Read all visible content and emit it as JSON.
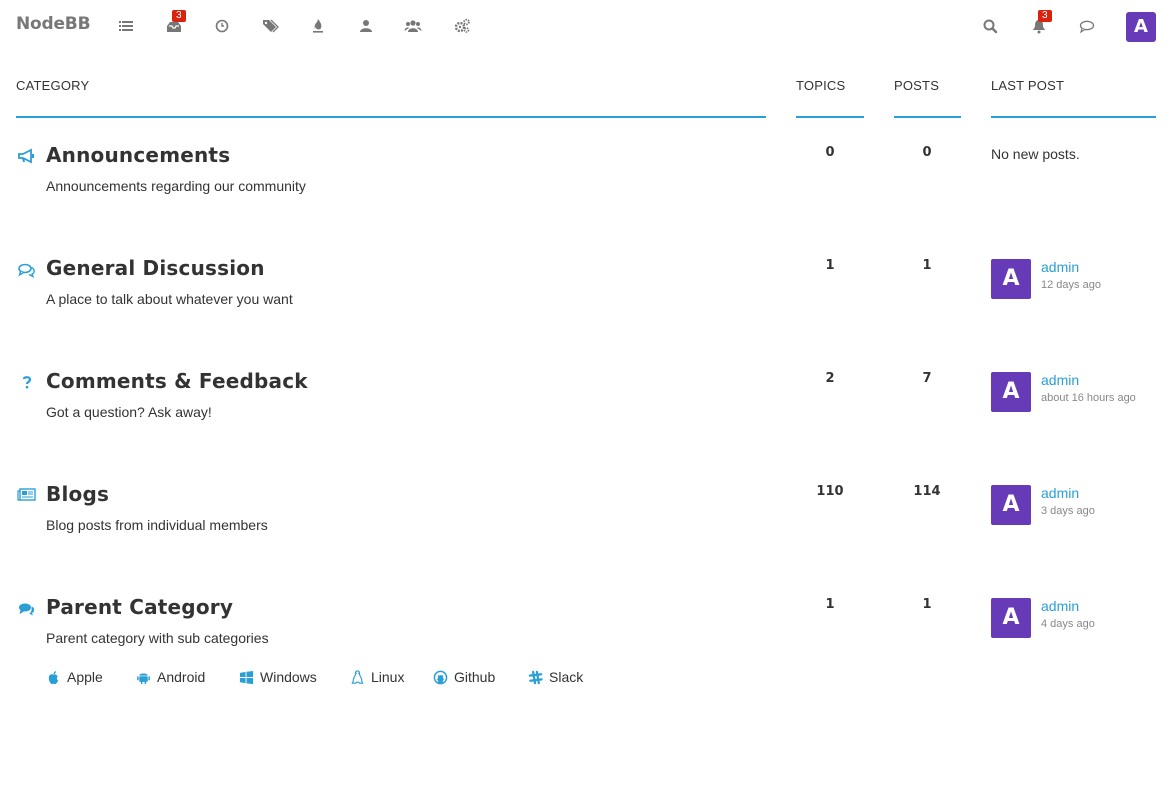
{
  "brand": "NodeBB",
  "nav": {
    "unread_badge": "3",
    "notifications_badge": "3",
    "user_avatar_letter": "A"
  },
  "headers": {
    "category": "CATEGORY",
    "topics": "TOPICS",
    "posts": "POSTS",
    "last_post": "LAST POST"
  },
  "colors": {
    "accent": "#2a9fd6",
    "avatar": "#673ab7",
    "badge": "#d9230f"
  },
  "categories": [
    {
      "icon": "bullhorn-icon",
      "title": "Announcements",
      "description": "Announcements regarding our community",
      "topics": "0",
      "posts": "0",
      "last_post": {
        "empty_text": "No new posts."
      }
    },
    {
      "icon": "comments-outline-icon",
      "title": "General Discussion",
      "description": "A place to talk about whatever you want",
      "topics": "1",
      "posts": "1",
      "last_post": {
        "avatar": "A",
        "user": "admin",
        "time": "12 days ago"
      }
    },
    {
      "icon": "question-icon",
      "title": "Comments & Feedback",
      "description": "Got a question? Ask away!",
      "topics": "2",
      "posts": "7",
      "last_post": {
        "avatar": "A",
        "user": "admin",
        "time": "about 16 hours ago"
      }
    },
    {
      "icon": "newspaper-icon",
      "title": "Blogs",
      "description": "Blog posts from individual members",
      "topics": "110",
      "posts": "114",
      "last_post": {
        "avatar": "A",
        "user": "admin",
        "time": "3 days ago"
      }
    },
    {
      "icon": "comments-icon",
      "title": "Parent Category",
      "description": "Parent category with sub categories",
      "topics": "1",
      "posts": "1",
      "last_post": {
        "avatar": "A",
        "user": "admin",
        "time": "4 days ago"
      }
    }
  ],
  "subcategories": [
    {
      "icon": "apple-icon",
      "label": "Apple"
    },
    {
      "icon": "android-icon",
      "label": "Android"
    },
    {
      "icon": "windows-icon",
      "label": "Windows"
    },
    {
      "icon": "linux-icon",
      "label": "Linux"
    },
    {
      "icon": "github-icon",
      "label": "Github"
    },
    {
      "icon": "slack-icon",
      "label": "Slack"
    }
  ]
}
